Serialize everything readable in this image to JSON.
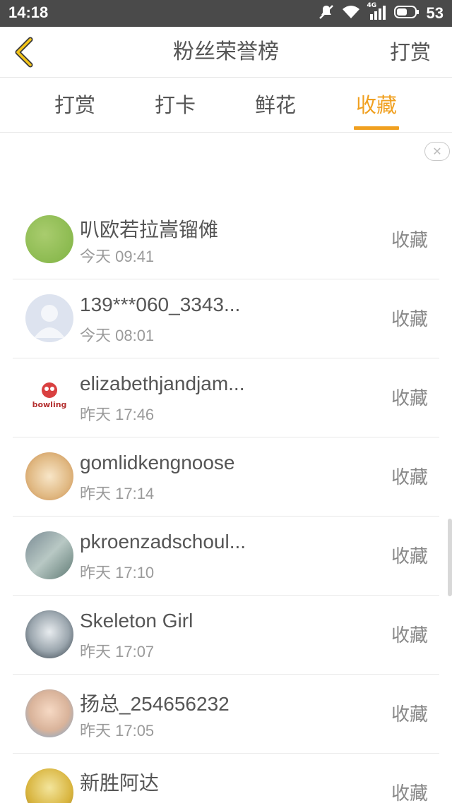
{
  "status_bar": {
    "time": "14:18",
    "battery": "53",
    "network": "4G",
    "icons": [
      "mute-icon",
      "wifi-icon",
      "signal-icon",
      "battery-icon"
    ]
  },
  "header": {
    "title": "粉丝荣誉榜",
    "action": "打赏"
  },
  "tabs": [
    {
      "label": "打赏",
      "active": false
    },
    {
      "label": "打卡",
      "active": false
    },
    {
      "label": "鲜花",
      "active": false
    },
    {
      "label": "收藏",
      "active": true
    }
  ],
  "accent_color": "#f0a020",
  "fans": [
    {
      "name": "叭欧若拉嵩镏傩",
      "time": "今天 09:41",
      "action": "收藏"
    },
    {
      "name": "139***060_3343...",
      "time": "今天 08:01",
      "action": "收藏"
    },
    {
      "name": "elizabethjandjam...",
      "time": "昨天 17:46",
      "action": "收藏"
    },
    {
      "name": "gomlidkengnoose",
      "time": "昨天 17:14",
      "action": "收藏"
    },
    {
      "name": "pkroenzadschoul...",
      "time": "昨天 17:10",
      "action": "收藏"
    },
    {
      "name": "Skeleton Girl",
      "time": "昨天 17:07",
      "action": "收藏"
    },
    {
      "name": "扬总_254656232",
      "time": "昨天 17:05",
      "action": "收藏"
    },
    {
      "name": "新胜阿达",
      "time": "",
      "action": "收藏"
    }
  ]
}
